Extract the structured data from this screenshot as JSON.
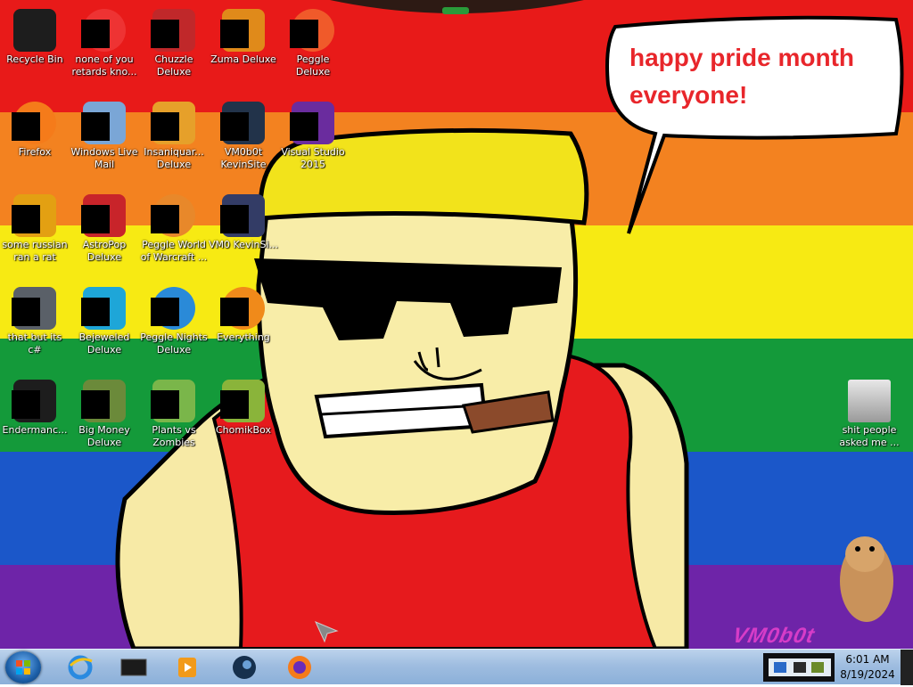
{
  "desktop": {
    "speech_bubble": "happy pride month everyone!",
    "signature": "VM0b0t",
    "icons": [
      {
        "label": "Recycle Bin",
        "icon": "recycle-bin-icon"
      },
      {
        "label": "none of you retards kno...",
        "icon": "shortcut-icon"
      },
      {
        "label": "Chuzzle Deluxe",
        "icon": "chuzzle-icon"
      },
      {
        "label": "Zuma Deluxe",
        "icon": "zuma-icon"
      },
      {
        "label": "Peggle Deluxe",
        "icon": "peggle-icon"
      },
      {
        "label": "Firefox",
        "icon": "firefox-icon"
      },
      {
        "label": "Windows Live Mail",
        "icon": "mail-icon"
      },
      {
        "label": "Insaniquar... Deluxe",
        "icon": "insaniquarium-icon"
      },
      {
        "label": "VM0b0t KevinSite",
        "icon": "website-icon"
      },
      {
        "label": "Visual Studio 2015",
        "icon": "visual-studio-icon"
      },
      {
        "label": "some russian ran a rat",
        "icon": "executable-icon"
      },
      {
        "label": "AstroPop Deluxe",
        "icon": "astropop-icon"
      },
      {
        "label": "Peggle World of Warcraft ...",
        "icon": "peggle-wow-icon"
      },
      {
        "label": "VM0 KevinSi...",
        "icon": "website-icon"
      },
      {
        "label": "that but its c#",
        "icon": "document-stack-icon"
      },
      {
        "label": "Bejeweled Deluxe",
        "icon": "bejeweled-icon"
      },
      {
        "label": "Peggle Nights Deluxe",
        "icon": "peggle-nights-icon"
      },
      {
        "label": "Everything",
        "icon": "search-icon"
      },
      {
        "label": "Endermanc...",
        "icon": "console-icon"
      },
      {
        "label": "Big Money Deluxe",
        "icon": "money-bag-icon"
      },
      {
        "label": "Plants vs Zombies",
        "icon": "plants-vs-zombies-icon"
      },
      {
        "label": "ChomikBox",
        "icon": "chomikbox-icon"
      },
      {
        "label": "shit people asked me ...",
        "icon": "folder-icon"
      }
    ]
  },
  "taskbar": {
    "pinned": [
      "internet-explorer-icon",
      "console-icon",
      "media-player-icon",
      "steam-icon",
      "firefox-icon"
    ],
    "tray_icons": [
      "network-icon",
      "speaker-icon",
      "tray-app-icon"
    ],
    "clock_time": "6:01 AM",
    "clock_date": "8/19/2024"
  }
}
